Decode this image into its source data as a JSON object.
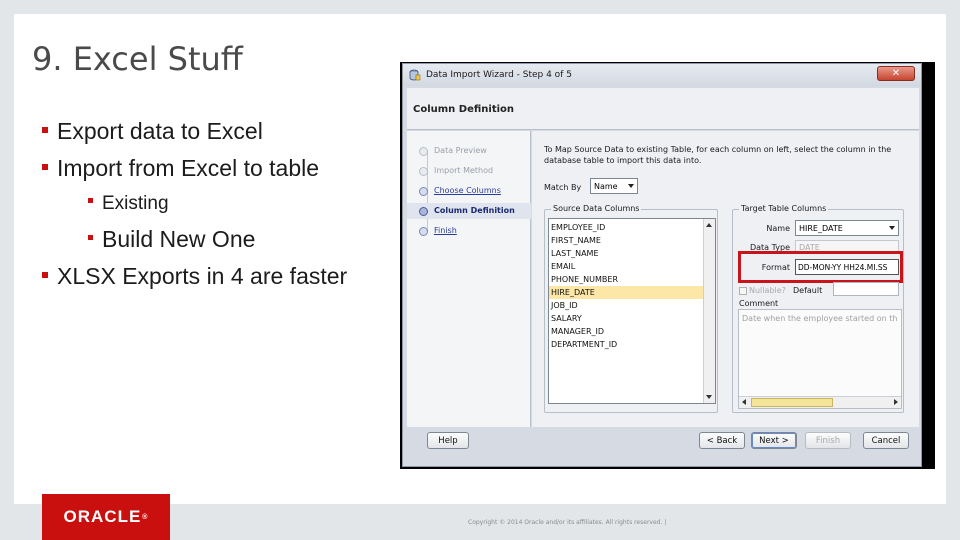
{
  "slide": {
    "title": "9. Excel Stuff",
    "bullets": [
      "Export data to Excel",
      "Import from Excel to table",
      "Existing",
      "Build New One",
      "XLSX Exports in 4 are faster"
    ],
    "logo": "ORACLE",
    "copyright": "Copyright © 2014 Oracle and/or its affiliates. All rights reserved. |"
  },
  "dialog": {
    "title": "Data Import Wizard - Step 4 of 5",
    "close": "✕",
    "heading": "Column Definition",
    "steps": [
      {
        "label": "Data Preview",
        "state": "done"
      },
      {
        "label": "Import Method",
        "state": "done"
      },
      {
        "label": "Choose Columns",
        "state": "link"
      },
      {
        "label": "Column Definition",
        "state": "active"
      },
      {
        "label": "Finish",
        "state": "link"
      }
    ],
    "instructions": "To Map Source Data to existing Table, for each column on left, select the column in the database table to import this data into.",
    "match_by": {
      "label": "Match By",
      "value": "Name"
    },
    "source": {
      "title": "Source Data Columns",
      "columns": [
        "EMPLOYEE_ID",
        "FIRST_NAME",
        "LAST_NAME",
        "EMAIL",
        "PHONE_NUMBER",
        "HIRE_DATE",
        "JOB_ID",
        "SALARY",
        "MANAGER_ID",
        "DEPARTMENT_ID"
      ],
      "selected": "HIRE_DATE"
    },
    "target": {
      "title": "Target Table Columns",
      "name_label": "Name",
      "name_value": "HIRE_DATE",
      "datatype_label": "Data Type",
      "datatype_value": "DATE",
      "format_label": "Format",
      "format_value": "DD-MON-YY HH24.MI.SS",
      "nullable_label": "Nullable?",
      "default_label": "Default",
      "comment_label": "Comment",
      "comment_value": "Date when the employee started on this"
    },
    "buttons": {
      "help": "Help",
      "back": "< Back",
      "next": "Next >",
      "finish": "Finish",
      "cancel": "Cancel"
    }
  }
}
